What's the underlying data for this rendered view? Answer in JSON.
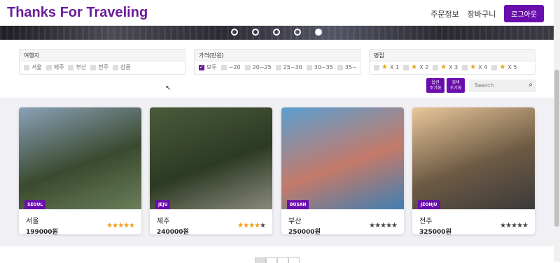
{
  "header": {
    "brand": "Thanks For Traveling",
    "nav_orders": "주문정보",
    "nav_cart": "장바구니",
    "logout": "로그아웃"
  },
  "carousel": {
    "slide_count": 5,
    "active_index": 4
  },
  "filters": {
    "destination": {
      "title": "여행지",
      "options": [
        "서울",
        "제주",
        "부산",
        "전주",
        "강릉"
      ]
    },
    "price": {
      "title": "가격(만원)",
      "options": [
        "모두",
        "~20",
        "20~25",
        "25~30",
        "30~35",
        "35~"
      ],
      "checked": "모두"
    },
    "rating": {
      "title": "평점",
      "options": [
        "X 1",
        "X 2",
        "X 3",
        "X 4",
        "X 5"
      ]
    }
  },
  "buttons": {
    "option_search": "옵션\n조기화",
    "search_reset": "검색\n조기화"
  },
  "search": {
    "placeholder": "Search"
  },
  "cards": [
    {
      "badge": "SEOUL",
      "name": "서울",
      "price": "199000원",
      "rating": 5,
      "colors": [
        "#8aa1b8",
        "#3a4a2e",
        "#6a7f5a"
      ]
    },
    {
      "badge": "JEJU",
      "name": "제주",
      "price": "240000원",
      "rating": 4,
      "colors": [
        "#4b5a3a",
        "#2d3a24",
        "#8a8a7a"
      ]
    },
    {
      "badge": "BUSAN",
      "name": "부산",
      "price": "250000원",
      "rating": 0,
      "colors": [
        "#5a9fd0",
        "#c47a6a",
        "#3f7fb2"
      ]
    },
    {
      "badge": "JEONJU",
      "name": "전주",
      "price": "325000원",
      "rating": 0,
      "colors": [
        "#e8c79a",
        "#6e5a44",
        "#3a3a3a"
      ]
    }
  ],
  "pagination": {
    "pages": 4,
    "active": 1
  }
}
